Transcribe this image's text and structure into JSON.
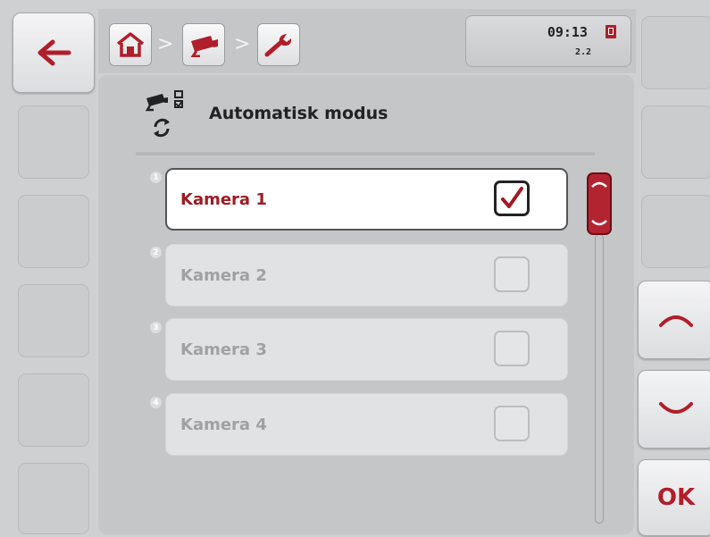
{
  "header": {
    "time": "09:13",
    "version": "2.2",
    "breadcrumb": [
      {
        "icon": "home-icon"
      },
      {
        "icon": "camera-icon"
      },
      {
        "icon": "wrench-icon"
      }
    ],
    "separator": ">"
  },
  "page": {
    "title": "Automatisk modus",
    "title_icon": "camera-auto-mode-icon"
  },
  "list": {
    "items": [
      {
        "number": "1",
        "label": "Kamera 1",
        "checked": true
      },
      {
        "number": "2",
        "label": "Kamera 2",
        "checked": false
      },
      {
        "number": "3",
        "label": "Kamera 3",
        "checked": false
      },
      {
        "number": "4",
        "label": "Kamera 4",
        "checked": false
      }
    ]
  },
  "softkeys": {
    "back_icon": "arrow-left-icon",
    "scroll_up_icon": "chevron-up-icon",
    "scroll_down_icon": "chevron-down-icon",
    "ok_label": "OK"
  },
  "colors": {
    "accent_red": "#9e1b25",
    "scrollbar_red": "#b22530",
    "background": "#cfd0d2"
  }
}
